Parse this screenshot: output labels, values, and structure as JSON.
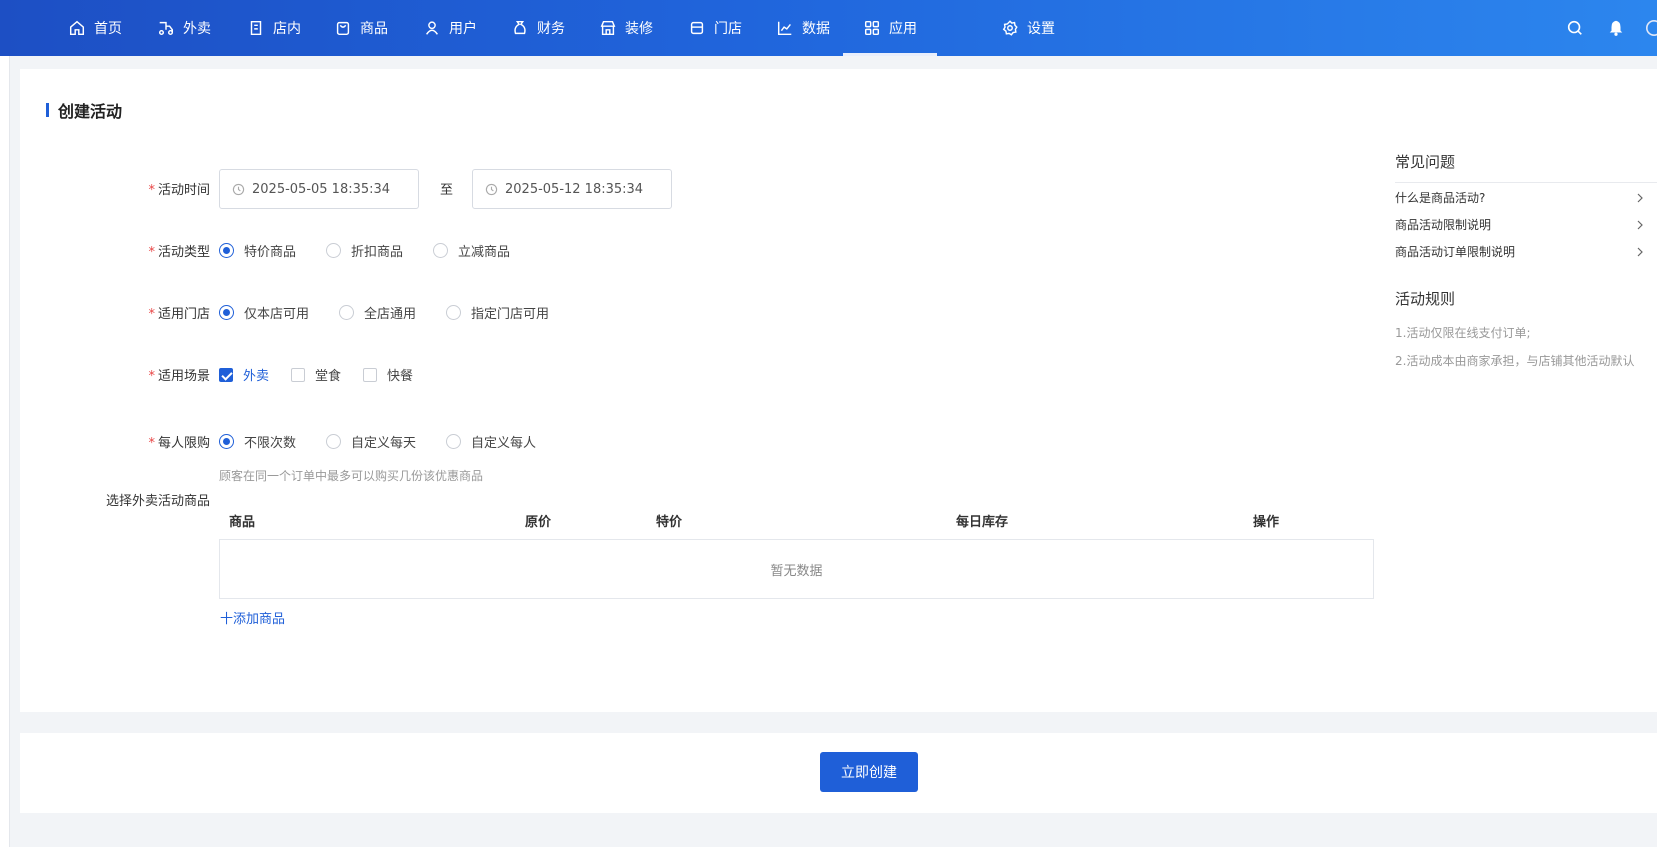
{
  "nav": {
    "items": [
      {
        "label": "首页",
        "icon": "home-icon"
      },
      {
        "label": "外卖",
        "icon": "delivery-icon"
      },
      {
        "label": "店内",
        "icon": "store-inside-icon"
      },
      {
        "label": "商品",
        "icon": "bag-icon"
      },
      {
        "label": "用户",
        "icon": "user-icon"
      },
      {
        "label": "财务",
        "icon": "money-bag-icon"
      },
      {
        "label": "装修",
        "icon": "shop-decor-icon"
      },
      {
        "label": "门店",
        "icon": "storefront-icon"
      },
      {
        "label": "数据",
        "icon": "line-chart-icon"
      },
      {
        "label": "应用",
        "icon": "apps-grid-icon",
        "active": true
      },
      {
        "label": "设置",
        "icon": "gear-icon"
      }
    ],
    "right_icons": [
      "search-icon",
      "bell-icon",
      "avatar-icon"
    ]
  },
  "form": {
    "title": "创建活动",
    "time": {
      "label": "活动时间",
      "start": "2025-05-05 18:35:34",
      "to": "至",
      "end": "2025-05-12 18:35:34"
    },
    "type": {
      "label": "活动类型",
      "options": [
        "特价商品",
        "折扣商品",
        "立减商品"
      ],
      "selected": "特价商品"
    },
    "store": {
      "label": "适用门店",
      "options": [
        "仅本店可用",
        "全店通用",
        "指定门店可用"
      ],
      "selected": "仅本店可用"
    },
    "scene": {
      "label": "适用场景",
      "options": [
        "外卖",
        "堂食",
        "快餐"
      ],
      "checked": [
        "外卖"
      ]
    },
    "limit": {
      "label": "每人限购",
      "options": [
        "不限次数",
        "自定义每天",
        "自定义每人"
      ],
      "selected": "不限次数",
      "hint": "顾客在同一个订单中最多可以购买几份该优惠商品"
    },
    "products": {
      "label": "选择外卖活动商品",
      "columns": [
        "商品",
        "原价",
        "特价",
        "每日库存",
        "操作"
      ],
      "empty": "暂无数据",
      "add": "十添加商品"
    }
  },
  "side": {
    "faq_title": "常见问题",
    "faq": [
      "什么是商品活动?",
      "商品活动限制说明",
      "商品活动订单限制说明"
    ],
    "rules_title": "活动规则",
    "rules": [
      "1.活动仅限在线支付订单;",
      "2.活动成本由商家承担，与店铺其他活动默认"
    ]
  },
  "footer": {
    "submit": "立即创建"
  },
  "colors": {
    "primary": "#1f5fd8",
    "required": "#e84545",
    "nav_start": "#1d4fc4",
    "nav_end": "#2c86ee"
  }
}
